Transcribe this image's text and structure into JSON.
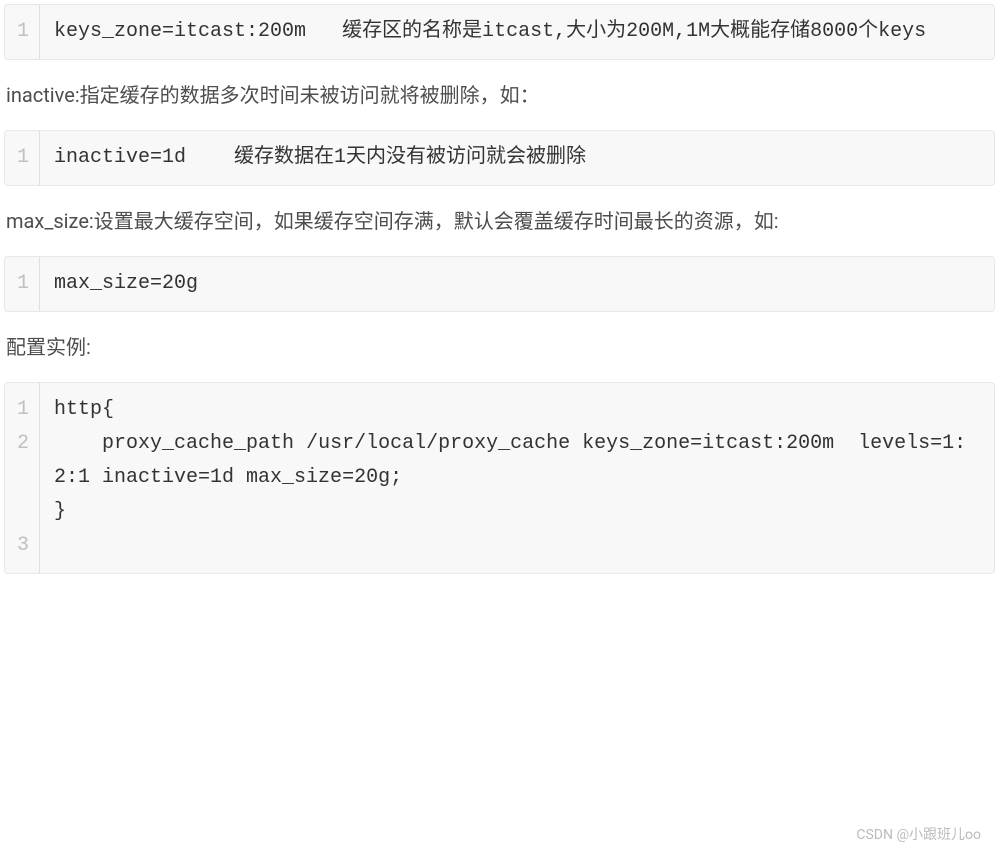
{
  "blocks": [
    {
      "type": "code",
      "lines": [
        "1"
      ],
      "content": "keys_zone=itcast:200m   缓存区的名称是itcast,大小为200M,1M大概能存储8000个keys"
    },
    {
      "type": "paragraph",
      "text": "inactive:指定缓存的数据多次时间未被访问就将被删除，如："
    },
    {
      "type": "code",
      "lines": [
        "1"
      ],
      "content": "inactive=1d    缓存数据在1天内没有被访问就会被删除"
    },
    {
      "type": "paragraph",
      "text": "max_size:设置最大缓存空间，如果缓存空间存满，默认会覆盖缓存时间最长的资源，如:"
    },
    {
      "type": "code",
      "lines": [
        "1"
      ],
      "content": "max_size=20g"
    },
    {
      "type": "paragraph",
      "text": "配置实例:"
    },
    {
      "type": "code",
      "lines": [
        "1",
        "2",
        "3"
      ],
      "content": "http{\n    proxy_cache_path /usr/local/proxy_cache keys_zone=itcast:200m  levels=1:2:1 inactive=1d max_size=20g;\n}"
    }
  ],
  "watermark": "CSDN @小跟班儿oo"
}
